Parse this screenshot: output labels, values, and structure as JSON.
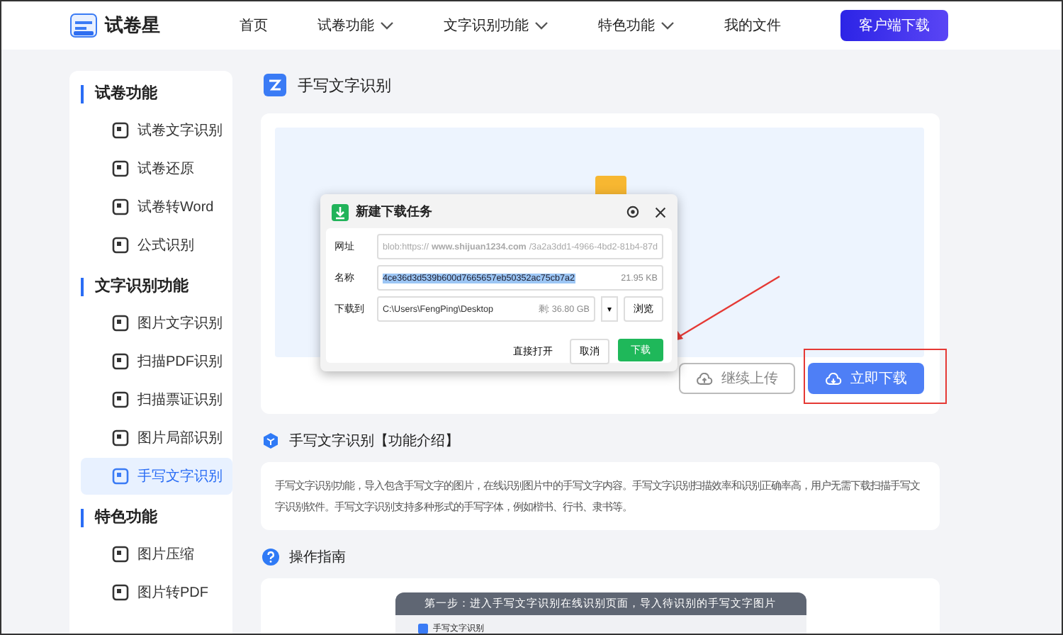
{
  "header": {
    "logo_text": "试卷星",
    "nav": [
      {
        "label": "首页",
        "kind": "link"
      },
      {
        "label": "试卷功能",
        "kind": "dropdown"
      },
      {
        "label": "文字识别功能",
        "kind": "dropdown"
      },
      {
        "label": "特色功能",
        "kind": "dropdown"
      },
      {
        "label": "我的文件",
        "kind": "link"
      }
    ],
    "download_button": "客户端下载"
  },
  "sidebar": {
    "groups": [
      {
        "title": "试卷功能",
        "items": [
          {
            "label": "试卷文字识别",
            "selected": false
          },
          {
            "label": "试卷还原",
            "selected": false
          },
          {
            "label": "试卷转Word",
            "selected": false
          },
          {
            "label": "公式识别",
            "selected": false
          }
        ]
      },
      {
        "title": "文字识别功能",
        "items": [
          {
            "label": "图片文字识别",
            "selected": false
          },
          {
            "label": "扫描PDF识别",
            "selected": false
          },
          {
            "label": "扫描票证识别",
            "selected": false
          },
          {
            "label": "图片局部识别",
            "selected": false
          },
          {
            "label": "手写文字识别",
            "selected": true
          }
        ]
      },
      {
        "title": "特色功能",
        "items": [
          {
            "label": "图片压缩",
            "selected": false
          },
          {
            "label": "图片转PDF",
            "selected": false
          }
        ]
      }
    ]
  },
  "page_title": "手写文字识别",
  "upload_card": {
    "continue_button": "继续上传",
    "download_button": "立即下载"
  },
  "dialog": {
    "title": "新建下载任务",
    "url_label": "网址",
    "url_value": "blob:https://**www.shijuan1234.com**/3a2a3dd1-4966-4bd2-81b4-87d",
    "name_label": "名称",
    "name_value": "4ce36d3d539b600d7665657eb50352ac75cb7a2",
    "name_size": "21.95 KB",
    "save_label": "下载到",
    "save_path": "C:\\Users\\FengPing\\Desktop",
    "free_space": "剩: 36.80 GB",
    "dropdown": "▾",
    "browse_button": "浏览",
    "open_button": "直接打开",
    "cancel_button": "取消",
    "download_button": "下载"
  },
  "intro": {
    "heading": "手写文字识别【功能介绍】",
    "text": "手写文字识别功能，导入包含手写文字的图片，在线识别图片中的手写文字内容。手写文字识别扫描效率和识别正确率高，用户无需下载扫描手写文字识别软件。手写文字识别支持多种形式的手写字体，例如楷书、行书、隶书等。"
  },
  "guide": {
    "heading": "操作指南",
    "step_title": "第一步：进入手写文字识别在线识别页面，导入待识别的手写文字图片",
    "inner_title": "手写文字识别"
  }
}
